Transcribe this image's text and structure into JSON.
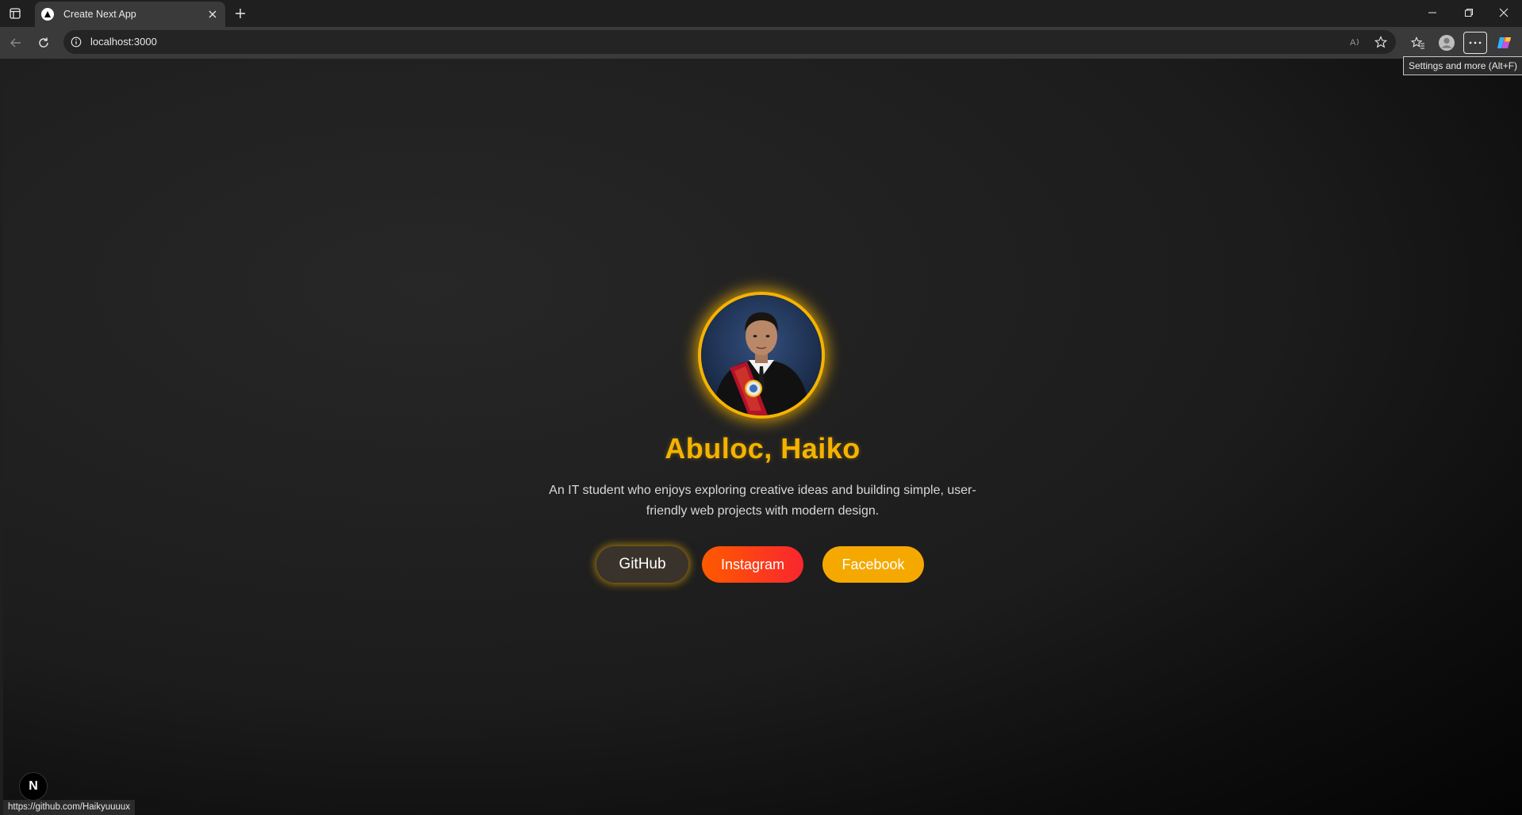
{
  "browser": {
    "tab": {
      "title": "Create Next App"
    },
    "address": {
      "url": "localhost:3000"
    },
    "tooltip": "Settings and more (Alt+F)",
    "status_url": "https://github.com/Haikyuuuux"
  },
  "page": {
    "name": "Abuloc, Haiko",
    "bio": "An IT student who enjoys exploring creative ideas and building simple, user-friendly web projects with modern design.",
    "buttons": {
      "github": "GitHub",
      "instagram": "Instagram",
      "facebook": "Facebook"
    },
    "dev_badge": "N"
  },
  "colors": {
    "accent": "#f5b301",
    "instagram_start": "#ff5a00",
    "instagram_end": "#f9262e",
    "facebook": "#f5a900",
    "background": "#1c1c1c"
  }
}
